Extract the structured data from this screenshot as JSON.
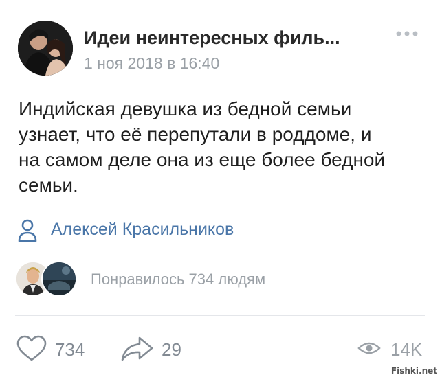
{
  "post": {
    "group_name": "Идеи неинтересных филь...",
    "date": "1 ноя 2018 в 16:40",
    "text": "Индийская девушка из бедной семьи\nузнает, что её перепутали в роддоме, и\nна самом деле она из еще более бедной\nсемьи.",
    "author": "Алексей Красильников",
    "liked_by_text": "Понравилось 734 людям"
  },
  "actions": {
    "likes": "734",
    "shares": "29",
    "views": "14K"
  },
  "icons": {
    "more": "more-dots-icon",
    "author": "person-icon",
    "like": "heart-icon",
    "share": "share-arrow-icon",
    "views": "eye-icon"
  },
  "colors": {
    "link": "#4a76a8",
    "muted": "#9aa0a6",
    "icon": "#828a93"
  },
  "watermark": "Fishki.net"
}
